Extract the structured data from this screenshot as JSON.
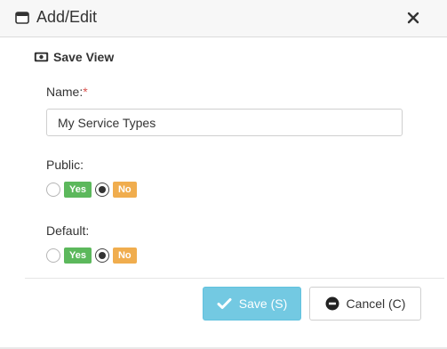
{
  "dialog": {
    "title": "Add/Edit",
    "close_icon": "close-icon",
    "window_icon": "window-icon"
  },
  "section": {
    "icon": "money-icon",
    "title": "Save View"
  },
  "form": {
    "name_label": "Name:",
    "name_required": "*",
    "name_value": "My Service Types",
    "public_label": "Public:",
    "public_selected": "No",
    "default_label": "Default:",
    "default_selected": "No",
    "yes_label": "Yes",
    "no_label": "No"
  },
  "footer": {
    "save_label": "Save (S)",
    "cancel_label": "Cancel (C)",
    "save_icon": "check-icon",
    "cancel_icon": "minus-circle-icon"
  },
  "colors": {
    "yes_badge": "#5cb85c",
    "no_badge": "#f0ad4e",
    "save_button": "#5bc0de",
    "required": "#d9534f"
  }
}
